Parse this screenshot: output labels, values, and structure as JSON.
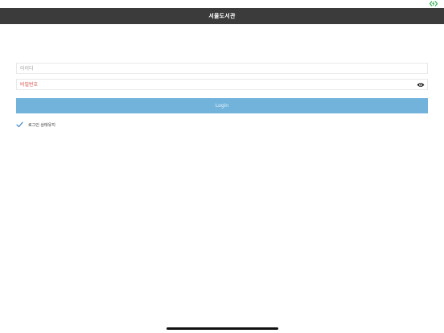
{
  "status_bar": {
    "battery_icon": "battery-charging-icon",
    "battery_color": "#2bb24c"
  },
  "nav": {
    "title": "서울도서관"
  },
  "login_form": {
    "id_placeholder": "아이디",
    "id_value": "",
    "password_placeholder": "비밀번호",
    "password_value": "",
    "show_password_icon": "eye-icon",
    "login_label": "Login",
    "keep_login": {
      "label": "로그인 상태유지",
      "checked": true
    }
  },
  "colors": {
    "nav_background": "#3b3b3b",
    "login_button": "#72b3dc",
    "password_placeholder": "#d9534f",
    "checkbox_accent": "#4a90c8"
  }
}
